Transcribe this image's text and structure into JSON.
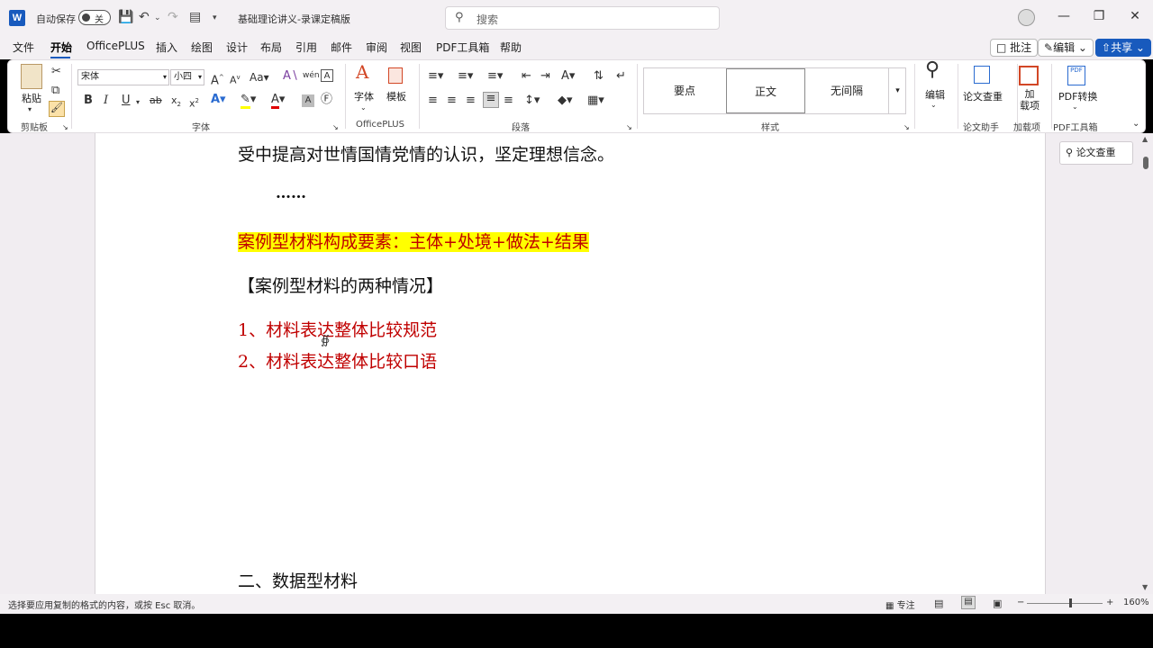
{
  "titlebar": {
    "app_icon": "W",
    "autosave_label": "自动保存",
    "autosave_state": "关",
    "doc_title": "基础理论讲义-录课定稿版",
    "search_placeholder": "搜索"
  },
  "menu": {
    "items": [
      "文件",
      "开始",
      "OfficePLUS",
      "插入",
      "绘图",
      "设计",
      "布局",
      "引用",
      "邮件",
      "审阅",
      "视图",
      "PDF工具箱",
      "帮助"
    ],
    "active": "开始",
    "comment_btn": "批注",
    "edit_btn": "编辑",
    "share_btn": "共享"
  },
  "ribbon": {
    "paste_label": "粘贴",
    "clipboard_group": "剪贴板",
    "font_name": "宋体",
    "font_size": "小四",
    "font_group": "字体",
    "font_btn": "字体",
    "template_btn": "模板",
    "officeplus_group": "OfficePLUS",
    "paragraph_group": "段落",
    "styles": [
      "要点",
      "正文",
      "无间隔"
    ],
    "styles_group": "样式",
    "edit_btn": "编辑",
    "thesis_btn": "论文查重",
    "thesis_group": "论文助手",
    "addin_btn": "加\n载项",
    "addin_group": "加载项",
    "pdf_btn": "PDF转换",
    "pdf_group": "PDF工具箱"
  },
  "document": {
    "line1": "受中提高对世情国情党情的认识，坚定理想信念。",
    "ellipsis": "……",
    "highlight_line": "案例型材料构成要素：主体+处境+做法+结果",
    "bracket_title": "【案例型材料的两种情况】",
    "item1": "1、材料表达整体比较规范",
    "item2": "2、材料表达整体比较口语",
    "heading2": "二、数据型材料"
  },
  "sidepanel": {
    "thesis_btn": "论文查重"
  },
  "status": {
    "message": "选择要应用复制的格式的内容，或按 Esc 取消。",
    "focus": "专注",
    "zoom": "160%"
  }
}
